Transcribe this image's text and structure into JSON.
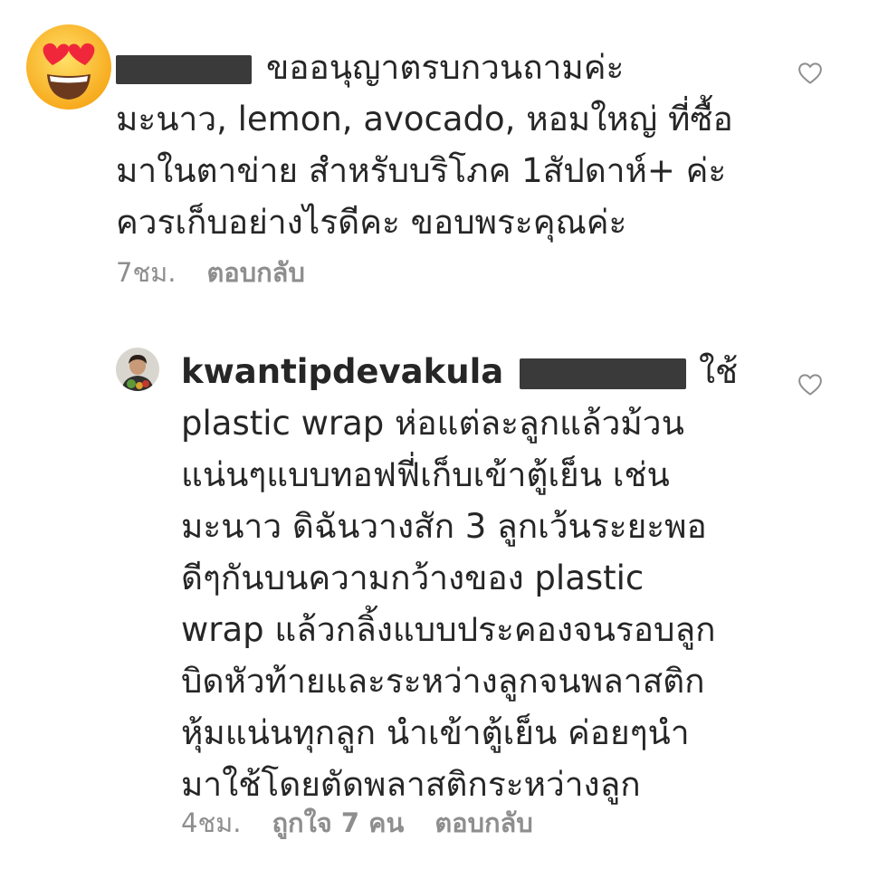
{
  "comments": [
    {
      "avatar": "heart-eyes-emoji",
      "lines": [
        "ขออนุญาตรบกวนถามค่ะ",
        "มะนาว, lemon, avocado, หอมใหญ่ ที่ซื้อ",
        "มาในตาข่าย สำหรับบริโภค 1สัปดาห์+ ค่ะ",
        "ควรเก็บอย่างไรดีคะ ขอบพระคุณค่ะ"
      ],
      "time": "7ชม.",
      "reply_label": "ตอบกลับ",
      "like_icon": "heart-outline-icon"
    },
    {
      "avatar": "profile-photo",
      "username": "kwantipdevakula",
      "first_line_suffix": "ใช้",
      "lines": [
        "plastic wrap ห่อแต่ละลูกแล้วม้วน",
        "แน่นๆแบบทอฟฟี่เก็บเข้าตู้เย็น เช่น",
        "มะนาว ดิฉันวางสัก 3 ลูกเว้นระยะพอ",
        "ดีๆกันบนความกว้างของ plastic",
        "wrap แล้วกลิ้งแบบประคองจนรอบลูก",
        "บิดหัวท้ายและระหว่างลูกจนพลาสติก",
        "หุ้มแน่นทุกลูก นำเข้าตู้เย็น ค่อยๆนำ",
        "มาใช้โดยตัดพลาสติกระหว่างลูก"
      ],
      "time": "4ชม.",
      "likes_label": "ถูกใจ 7 คน",
      "reply_label": "ตอบกลับ",
      "like_icon": "heart-outline-icon"
    }
  ],
  "colors": {
    "text": "#262626",
    "meta": "#8e8e8e",
    "redaction": "#3a3a3a",
    "emoji_face": "#ffcc33"
  }
}
